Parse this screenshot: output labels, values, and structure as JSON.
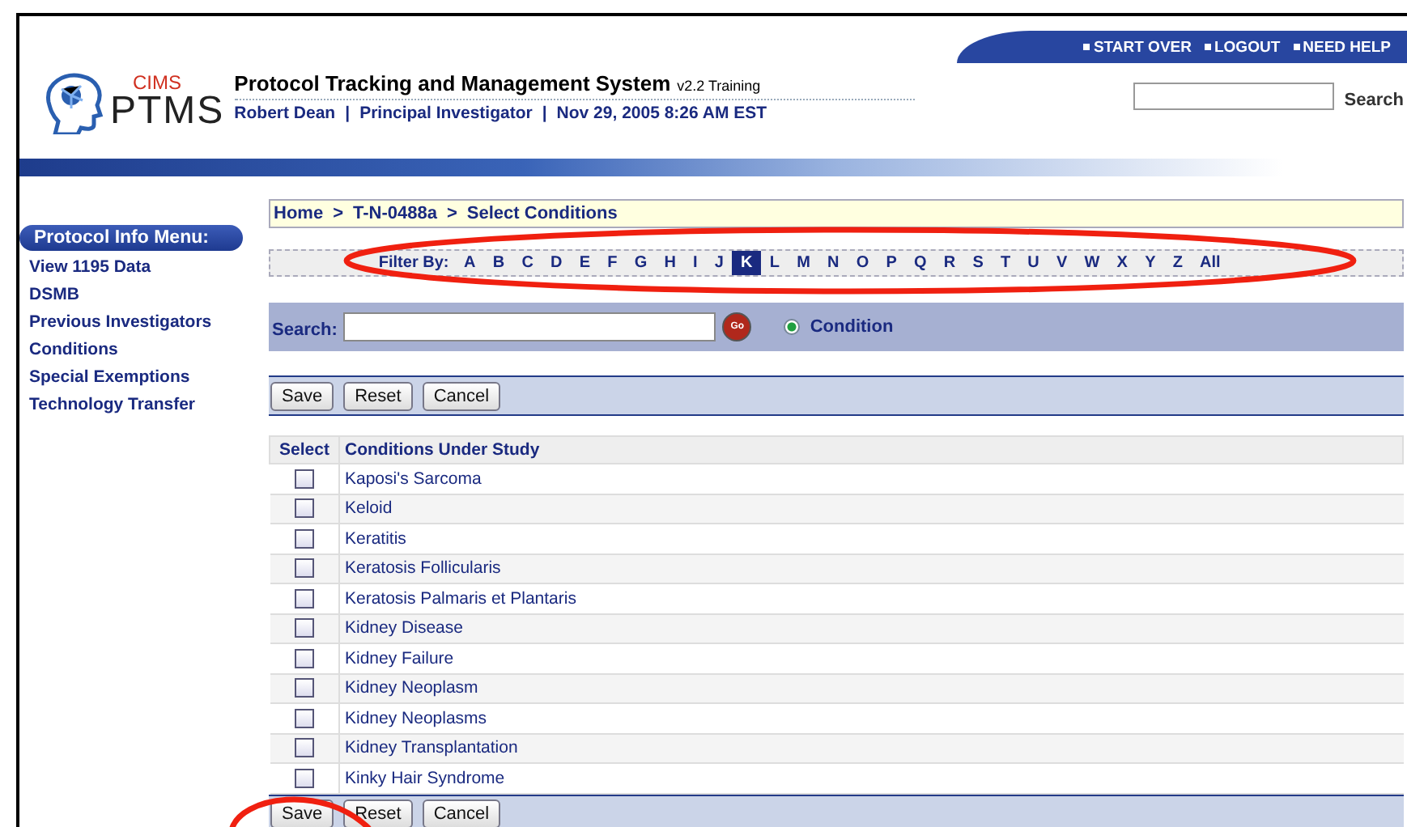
{
  "header": {
    "logo_small": "CIMS",
    "logo_large": "PTMS",
    "title": "Protocol Tracking and Management System",
    "version": "v2.2 Training",
    "user_line": [
      "Robert Dean",
      "|",
      "Principal Investigator",
      "|",
      "Nov 29, 2005 8:26 AM EST"
    ],
    "links": [
      "START OVER",
      "LOGOUT",
      "NEED HELP"
    ],
    "search_button": "Search"
  },
  "sidebar": {
    "heading": "Protocol Info Menu:",
    "items": [
      "View 1195 Data",
      "DSMB",
      "Previous Investigators",
      "Conditions",
      "Special Exemptions",
      "Technology Transfer"
    ]
  },
  "breadcrumb": [
    "Home",
    ">",
    "T-N-0488a",
    ">",
    "Select Conditions"
  ],
  "filter": {
    "label": "Filter By:",
    "letters": [
      {
        "label": "A",
        "selected": false
      },
      {
        "label": "B",
        "selected": false
      },
      {
        "label": "C",
        "selected": false
      },
      {
        "label": "D",
        "selected": false
      },
      {
        "label": "E",
        "selected": false
      },
      {
        "label": "F",
        "selected": false
      },
      {
        "label": "G",
        "selected": false
      },
      {
        "label": "H",
        "selected": false
      },
      {
        "label": "I",
        "selected": false
      },
      {
        "label": "J",
        "selected": false
      },
      {
        "label": "K",
        "selected": true
      },
      {
        "label": "L",
        "selected": false
      },
      {
        "label": "M",
        "selected": false
      },
      {
        "label": "N",
        "selected": false
      },
      {
        "label": "O",
        "selected": false
      },
      {
        "label": "P",
        "selected": false
      },
      {
        "label": "Q",
        "selected": false
      },
      {
        "label": "R",
        "selected": false
      },
      {
        "label": "S",
        "selected": false
      },
      {
        "label": "T",
        "selected": false
      },
      {
        "label": "U",
        "selected": false
      },
      {
        "label": "V",
        "selected": false
      },
      {
        "label": "W",
        "selected": false
      },
      {
        "label": "X",
        "selected": false
      },
      {
        "label": "Y",
        "selected": false
      },
      {
        "label": "Z",
        "selected": false
      },
      {
        "label": "All",
        "selected": false
      }
    ]
  },
  "search": {
    "label": "Search:",
    "go": "Go",
    "options": [
      {
        "label": "Condition",
        "selected": true
      }
    ]
  },
  "buttons": [
    "Save",
    "Reset",
    "Cancel"
  ],
  "table": {
    "columns": [
      "Select",
      "Conditions Under Study"
    ],
    "rows": [
      {
        "condition": "Kaposi's Sarcoma",
        "checked": false
      },
      {
        "condition": "Keloid",
        "checked": false
      },
      {
        "condition": "Keratitis",
        "checked": false
      },
      {
        "condition": "Keratosis Follicularis",
        "checked": false
      },
      {
        "condition": "Keratosis Palmaris et Plantaris",
        "checked": false
      },
      {
        "condition": "Kidney Disease",
        "checked": false
      },
      {
        "condition": "Kidney Failure",
        "checked": false
      },
      {
        "condition": "Kidney Neoplasm",
        "checked": false
      },
      {
        "condition": "Kidney Neoplasms",
        "checked": false
      },
      {
        "condition": "Kidney Transplantation",
        "checked": false
      },
      {
        "condition": "Kinky Hair Syndrome",
        "checked": false
      }
    ]
  },
  "bottom_buttons": [
    "Save",
    "Reset",
    "Cancel"
  ]
}
